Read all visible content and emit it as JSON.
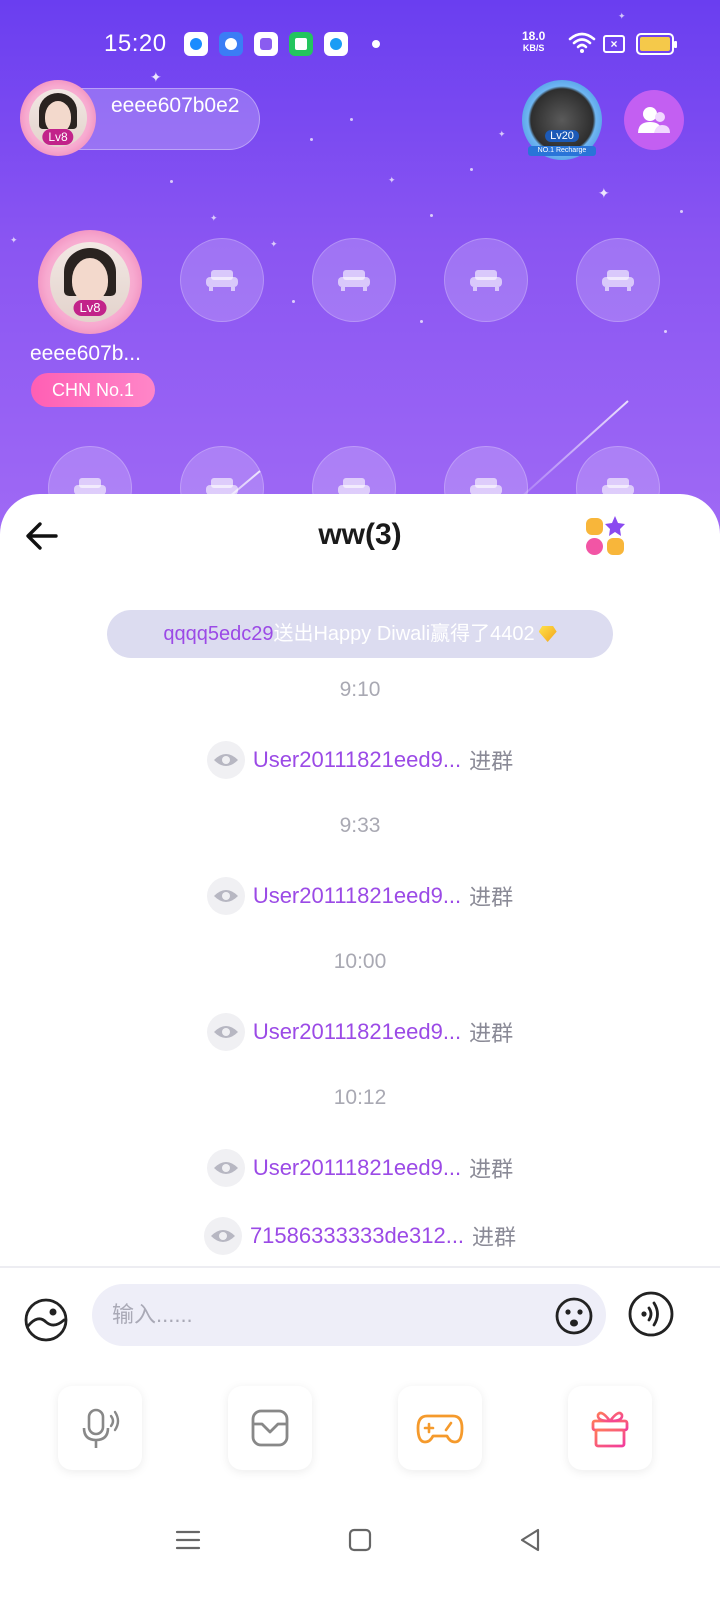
{
  "status_bar": {
    "time": "15:20",
    "speed": "18.0",
    "speed_unit": "KB/S",
    "battery_color": "#f5c94a"
  },
  "room": {
    "host_name": "eeee607b0e2",
    "host_level": "Lv8",
    "rank_level": "Lv20",
    "rank_ribbon": "NO.1 Recharge",
    "seat_owner_name": "eeee607b...",
    "seat_owner_level": "Lv8",
    "seat_badge": "CHN No.1",
    "accent_color": "#7b4af2"
  },
  "chat": {
    "title": "ww(3)",
    "gift_notice": {
      "user": "qqqq5edc29",
      "text": "送出Happy Diwali赢得了4402"
    },
    "events": [
      {
        "time": "9:10",
        "user": "User20111821eed9...",
        "action": "进群"
      },
      {
        "time": "9:33",
        "user": "User20111821eed9...",
        "action": "进群"
      },
      {
        "time": "10:00",
        "user": "User20111821eed9...",
        "action": "进群"
      },
      {
        "time": "10:12",
        "user": "User20111821eed9...",
        "action": "进群"
      }
    ],
    "last_event": {
      "user": "71586333333de312...",
      "action": "进群"
    },
    "input_placeholder": "输入......"
  },
  "icons": {
    "back": "arrow-left-icon",
    "apps": "apps-grid-icon",
    "image": "image-icon",
    "emoji": "emoji-icon",
    "voice": "voice-icon",
    "mic": "mic-icon",
    "box": "box-icon",
    "game": "gamepad-icon",
    "gift": "gift-icon"
  }
}
